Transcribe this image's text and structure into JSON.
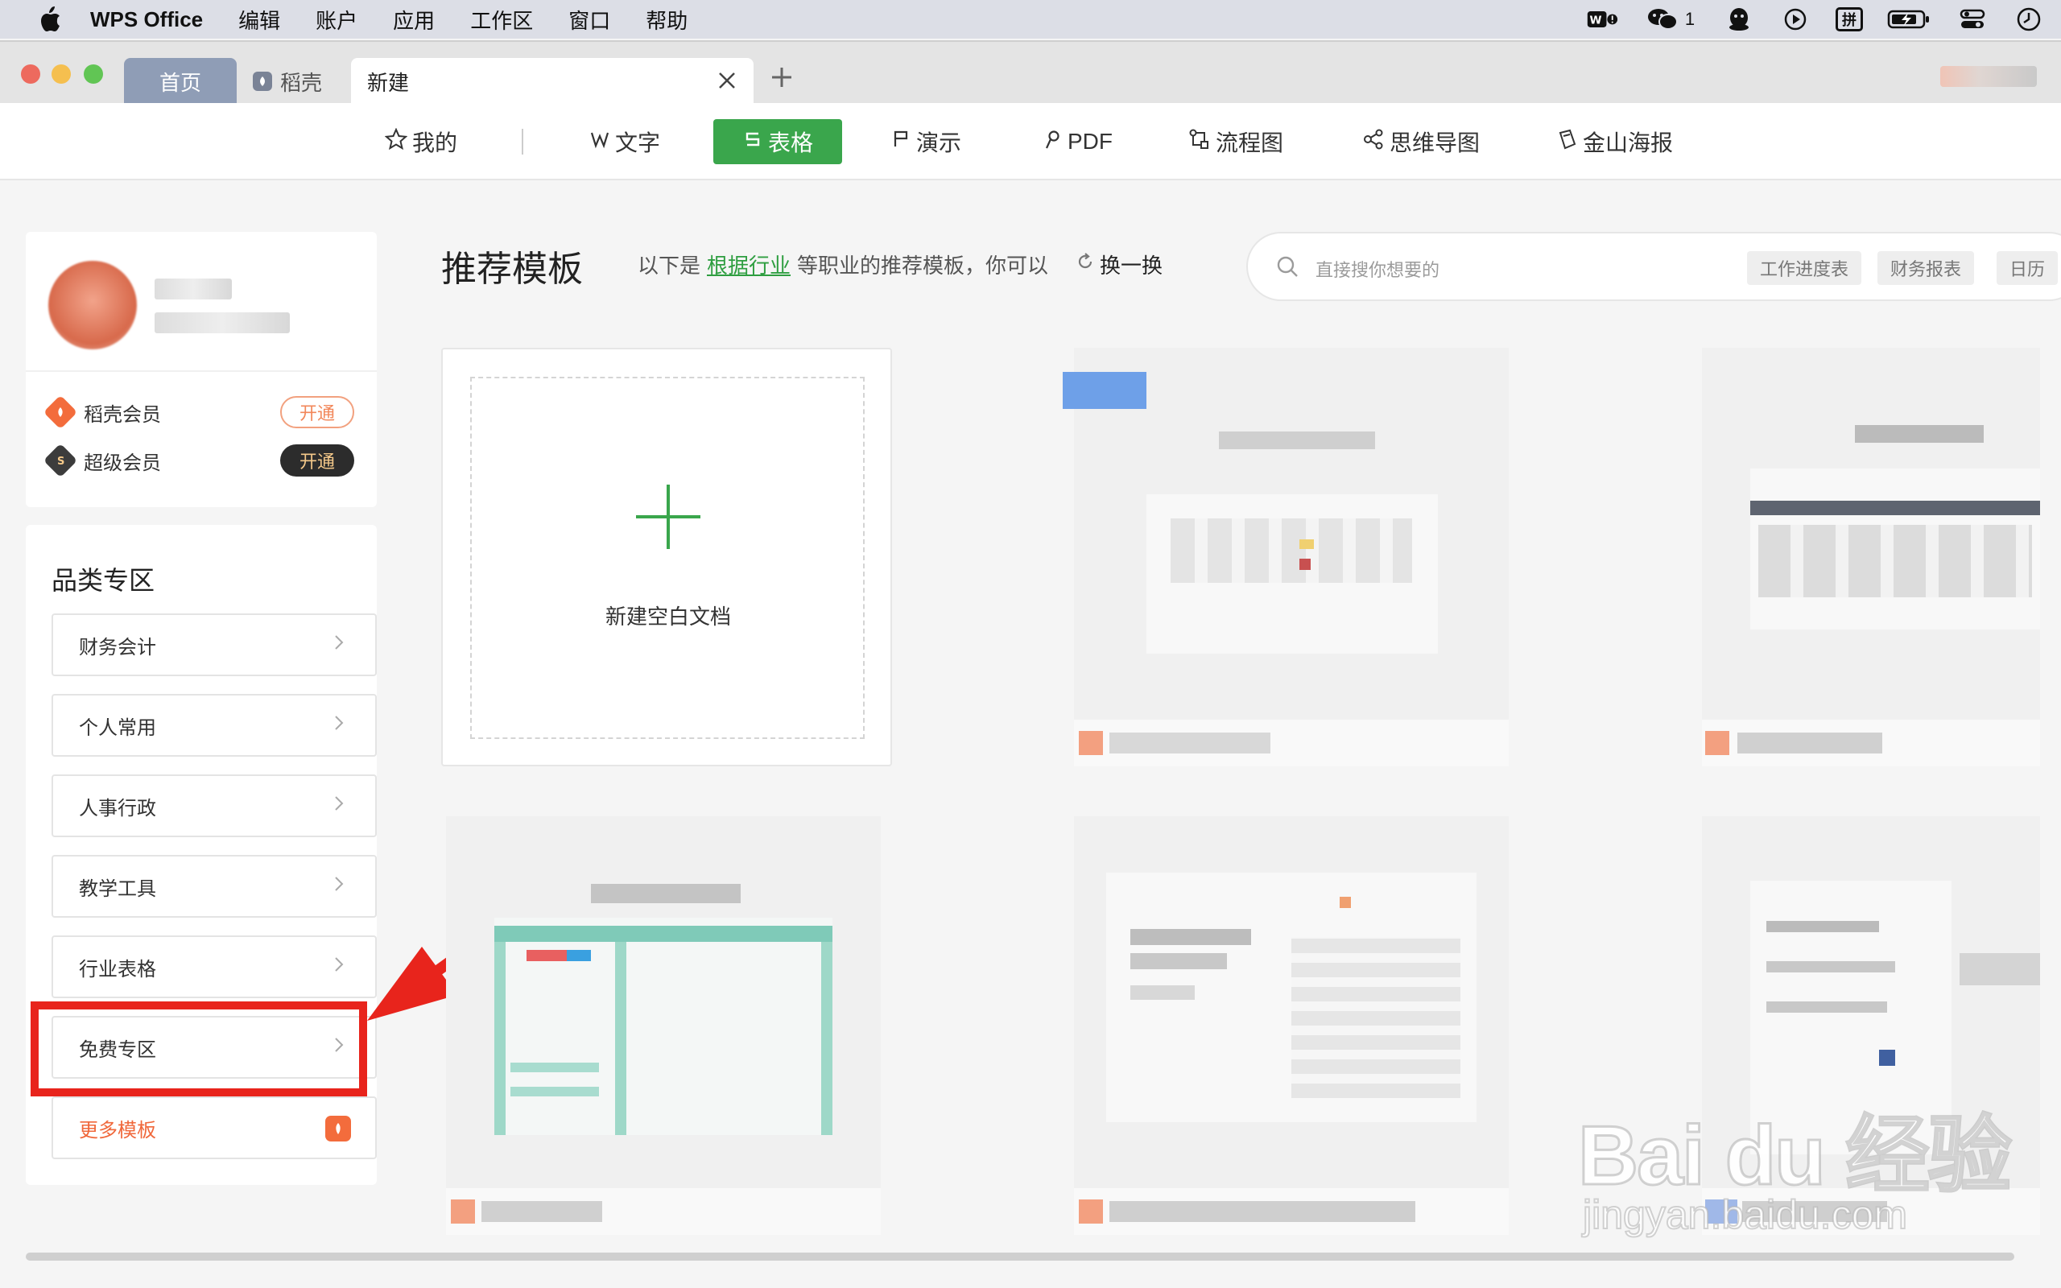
{
  "menubar": {
    "app_name": "WPS Office",
    "items": [
      "编辑",
      "账户",
      "应用",
      "工作区",
      "窗口",
      "帮助"
    ],
    "wechat_count": "1",
    "pinyin_label": "拼"
  },
  "tabs": {
    "home": "首页",
    "daoke": "稻壳",
    "new": "新建"
  },
  "nav": {
    "mine": "我的",
    "word": "文字",
    "sheet": "表格",
    "slides": "演示",
    "pdf": "PDF",
    "flow": "流程图",
    "mind": "思维导图",
    "poster": "金山海报",
    "active_color": "#3aa64c"
  },
  "membership": {
    "daoke_label": "稻壳会员",
    "daoke_button": "开通",
    "super_label": "超级会员",
    "super_button": "开通"
  },
  "categories": {
    "title": "品类专区",
    "items": [
      "财务会计",
      "个人常用",
      "人事行政",
      "教学工具",
      "行业表格",
      "免费专区"
    ],
    "more": "更多模板"
  },
  "main": {
    "title": "推荐模板",
    "subtitle_prefix": "以下是",
    "subtitle_link": "根据行业",
    "subtitle_suffix": "等职业的推荐模板，你可以",
    "refresh": "换一换",
    "search_placeholder": "直接搜你想要的",
    "tags": [
      "工作进度表",
      "财务报表",
      "日历"
    ],
    "new_blank": "新建空白文档"
  },
  "watermark": {
    "brand": "Bai du 经验",
    "url": "jingyan.baidu.com"
  },
  "colors": {
    "highlight": "#e8241c",
    "accent_orange": "#f36c3c",
    "link_green": "#2e9e40"
  }
}
